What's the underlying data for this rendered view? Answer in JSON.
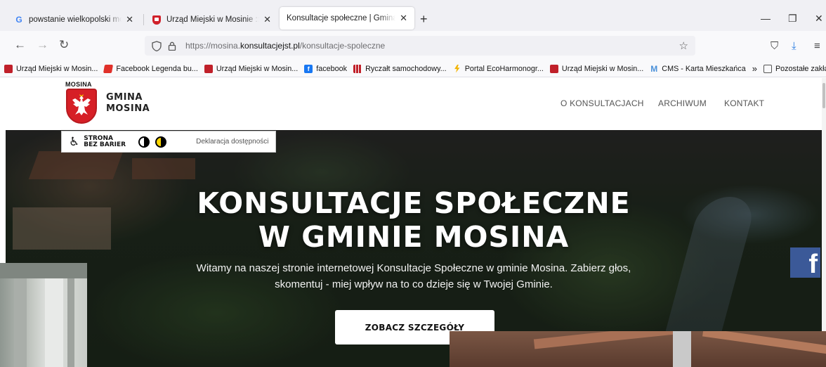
{
  "browser": {
    "tabs": [
      {
        "title": "powstanie wielkopolski mosina",
        "favicon": "google-icon",
        "active": false
      },
      {
        "title": "Urząd Miejski w Mosinie :: Nasza",
        "favicon": "coat-of-arms-icon",
        "active": false
      },
      {
        "title": "Konsultacje społeczne | Gmina Mosina",
        "favicon": "none",
        "active": true
      }
    ],
    "url_prefix": "https://mosina.",
    "url_domain": "konsultacjejst.pl",
    "url_path": "/konsultacje-spoleczne",
    "bookmarks": [
      {
        "label": "Urząd Miejski w Mosin...",
        "icon": "coat-of-arms-icon"
      },
      {
        "label": "Facebook Legenda bu...",
        "icon": "flame-icon"
      },
      {
        "label": "Urząd Miejski w Mosin...",
        "icon": "coat-of-arms-icon"
      },
      {
        "label": "facebook",
        "icon": "facebook-icon"
      },
      {
        "label": "Ryczałt samochodowy...",
        "icon": "grid-icon"
      },
      {
        "label": "Portal EcoHarmonogr...",
        "icon": "bolt-icon"
      },
      {
        "label": "Urząd Miejski w Mosin...",
        "icon": "coat-of-arms-icon"
      },
      {
        "label": "CMS - Karta Mieszkańca",
        "icon": "m-icon"
      }
    ],
    "bookmarks_overflow": "»",
    "other_bookmarks": "Pozostałe zakładki"
  },
  "site": {
    "logo_caption": "MOSINA",
    "brand_line1": "GMINA",
    "brand_line2": "MOSINA",
    "nav": [
      "O KONSULTACJACH",
      "ARCHIWUM",
      "KONTAKT"
    ],
    "accessibility": {
      "line1": "STRONA",
      "line2": "BEZ BARIER",
      "declaration": "Deklaracja dostępności"
    },
    "hero": {
      "title_line1": "KONSULTACJE SPOŁECZNE",
      "title_line2": "W GMINIE MOSINA",
      "subtitle_line1": "Witamy na naszej stronie internetowej Konsultacje Społeczne w gminie Mosina. Zabierz głos,",
      "subtitle_line2": "skomentuj - miej wpływ na to co dzieje się w Twojej Gminie.",
      "cta": "ZOBACZ SZCZEGÓŁY"
    },
    "facebook_side": "f"
  },
  "colors": {
    "brand_red": "#d61f26",
    "facebook_blue": "#3b5998",
    "chrome_bg": "#f0f0f4"
  }
}
